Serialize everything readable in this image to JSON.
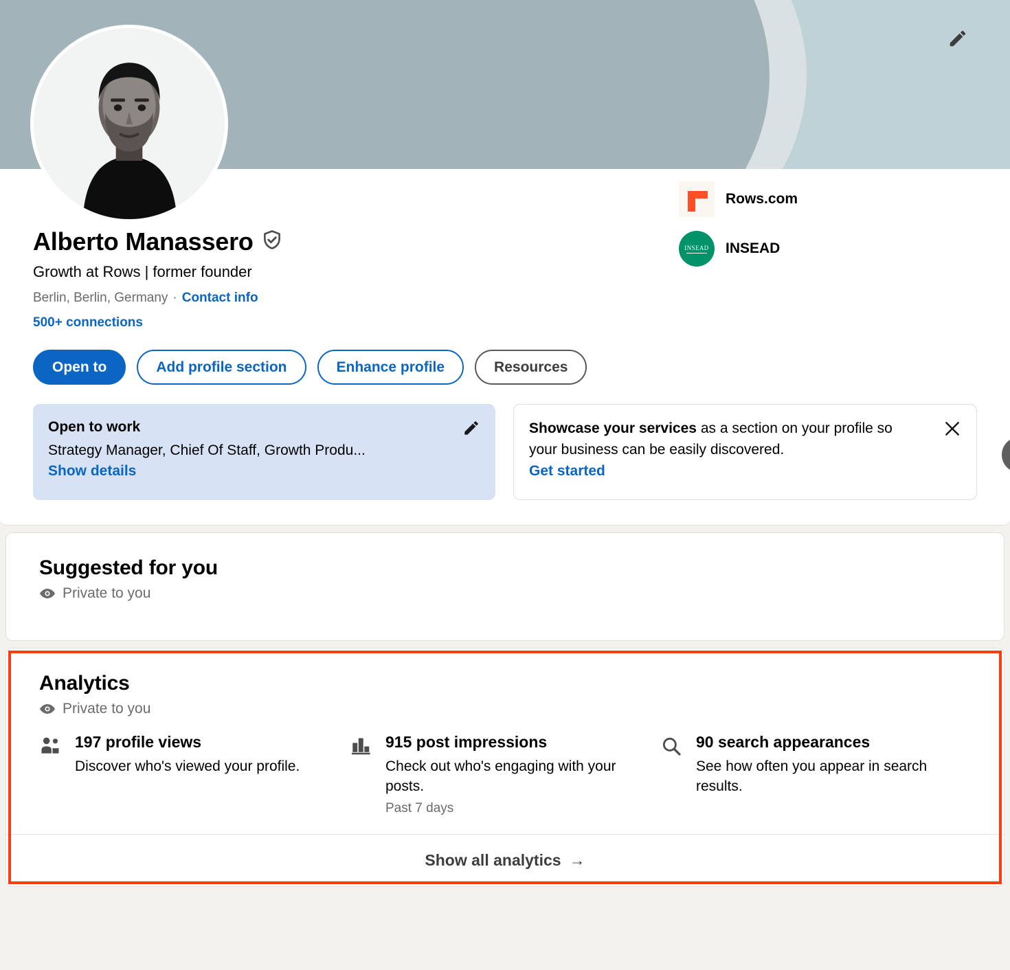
{
  "profile": {
    "name": "Alberto Manassero",
    "verified_icon": "verified-shield-icon",
    "headline": "Growth at Rows | former founder",
    "location": "Berlin, Berlin, Germany",
    "separator": "·",
    "contact_info_label": "Contact info",
    "connections_label": "500+ connections",
    "edit_icon": "pencil-icon",
    "avatar_alt": "profile-photo"
  },
  "organizations": [
    {
      "name": "Rows.com",
      "logo": "rows-logo"
    },
    {
      "name": "INSEAD",
      "logo": "insead-logo",
      "mark": "INSEAD"
    }
  ],
  "actions": [
    {
      "label": "Open to",
      "style": "primary"
    },
    {
      "label": "Add profile section",
      "style": "outline-blue"
    },
    {
      "label": "Enhance profile",
      "style": "outline-blue"
    },
    {
      "label": "Resources",
      "style": "outline-gray"
    }
  ],
  "promos": {
    "open_to_work": {
      "title": "Open to work",
      "subtitle": "Strategy Manager, Chief Of Staff, Growth Produ...",
      "link": "Show details",
      "icon": "pencil-icon"
    },
    "showcase": {
      "lead": "Showcase your services",
      "rest": " as a section on your profile so your business can be easily discovered.",
      "link": "Get started",
      "icon": "close-icon"
    },
    "next_icon": "chevron-right-icon"
  },
  "suggested": {
    "title": "Suggested for you",
    "privacy": "Private to you",
    "privacy_icon": "eye-icon"
  },
  "analytics": {
    "title": "Analytics",
    "privacy": "Private to you",
    "privacy_icon": "eye-icon",
    "metrics": [
      {
        "icon": "people-icon",
        "headline": "197 profile views",
        "description": "Discover who's viewed your profile.",
        "note": ""
      },
      {
        "icon": "bar-chart-icon",
        "headline": "915 post impressions",
        "description": "Check out who's engaging with your posts.",
        "note": "Past 7 days"
      },
      {
        "icon": "search-icon",
        "headline": "90 search appearances",
        "description": "See how often you appear in search results.",
        "note": ""
      }
    ],
    "show_all_label": "Show all analytics",
    "show_all_arrow": "→",
    "highlight_color": "#ff3c11"
  },
  "colors": {
    "accent_blue": "#0a66c2",
    "page_bg": "#f4f2ee",
    "banner_main": "#a2b4b9",
    "banner_light": "#d9e1e3",
    "banner_right": "#bed2d8",
    "rows_orange": "#ff4f26",
    "insead_green": "#009268"
  }
}
